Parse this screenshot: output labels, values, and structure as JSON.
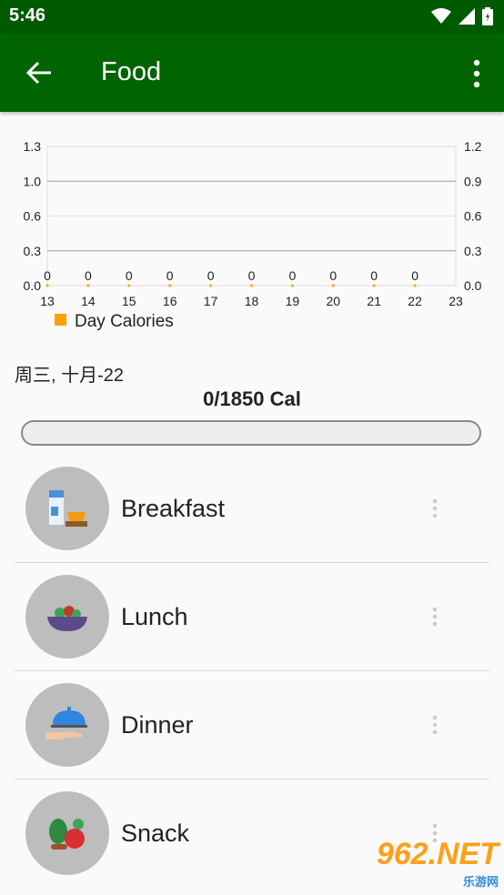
{
  "status_bar": {
    "time": "5:46"
  },
  "app_bar": {
    "title": "Food"
  },
  "chart_data": {
    "type": "line",
    "x": [
      13,
      14,
      15,
      16,
      17,
      18,
      19,
      20,
      21,
      22,
      23
    ],
    "left_ticks": [
      "1.3",
      "1.0",
      "0.6",
      "0.3",
      "0.0"
    ],
    "right_ticks": [
      "1.2",
      "0.9",
      "0.6",
      "0.3",
      "0.0"
    ],
    "series": [
      {
        "name": "Day Calories",
        "x": [
          13,
          14,
          15,
          16,
          17,
          18,
          19,
          20,
          21,
          22
        ],
        "values": [
          0,
          0,
          0,
          0,
          0,
          0,
          0,
          0,
          0,
          0
        ],
        "color": "#ffa000"
      }
    ],
    "data_labels": [
      "0",
      "0",
      "0",
      "0",
      "0",
      "0",
      "0",
      "0",
      "0",
      "0"
    ],
    "ylim": [
      0,
      1.3
    ],
    "legend": {
      "placement": "bottom-left",
      "label": "Day Calories"
    }
  },
  "summary": {
    "date": "周三, 十月-22",
    "calories": "0/1850 Cal",
    "progress": 0
  },
  "meals": [
    {
      "label": "Breakfast",
      "icon": "breakfast-icon"
    },
    {
      "label": "Lunch",
      "icon": "salad-bowl-icon"
    },
    {
      "label": "Dinner",
      "icon": "serving-cloche-icon"
    },
    {
      "label": "Snack",
      "icon": "vegetables-icon"
    }
  ],
  "watermark": {
    "brand": "962.NET",
    "sub": "乐游网"
  }
}
